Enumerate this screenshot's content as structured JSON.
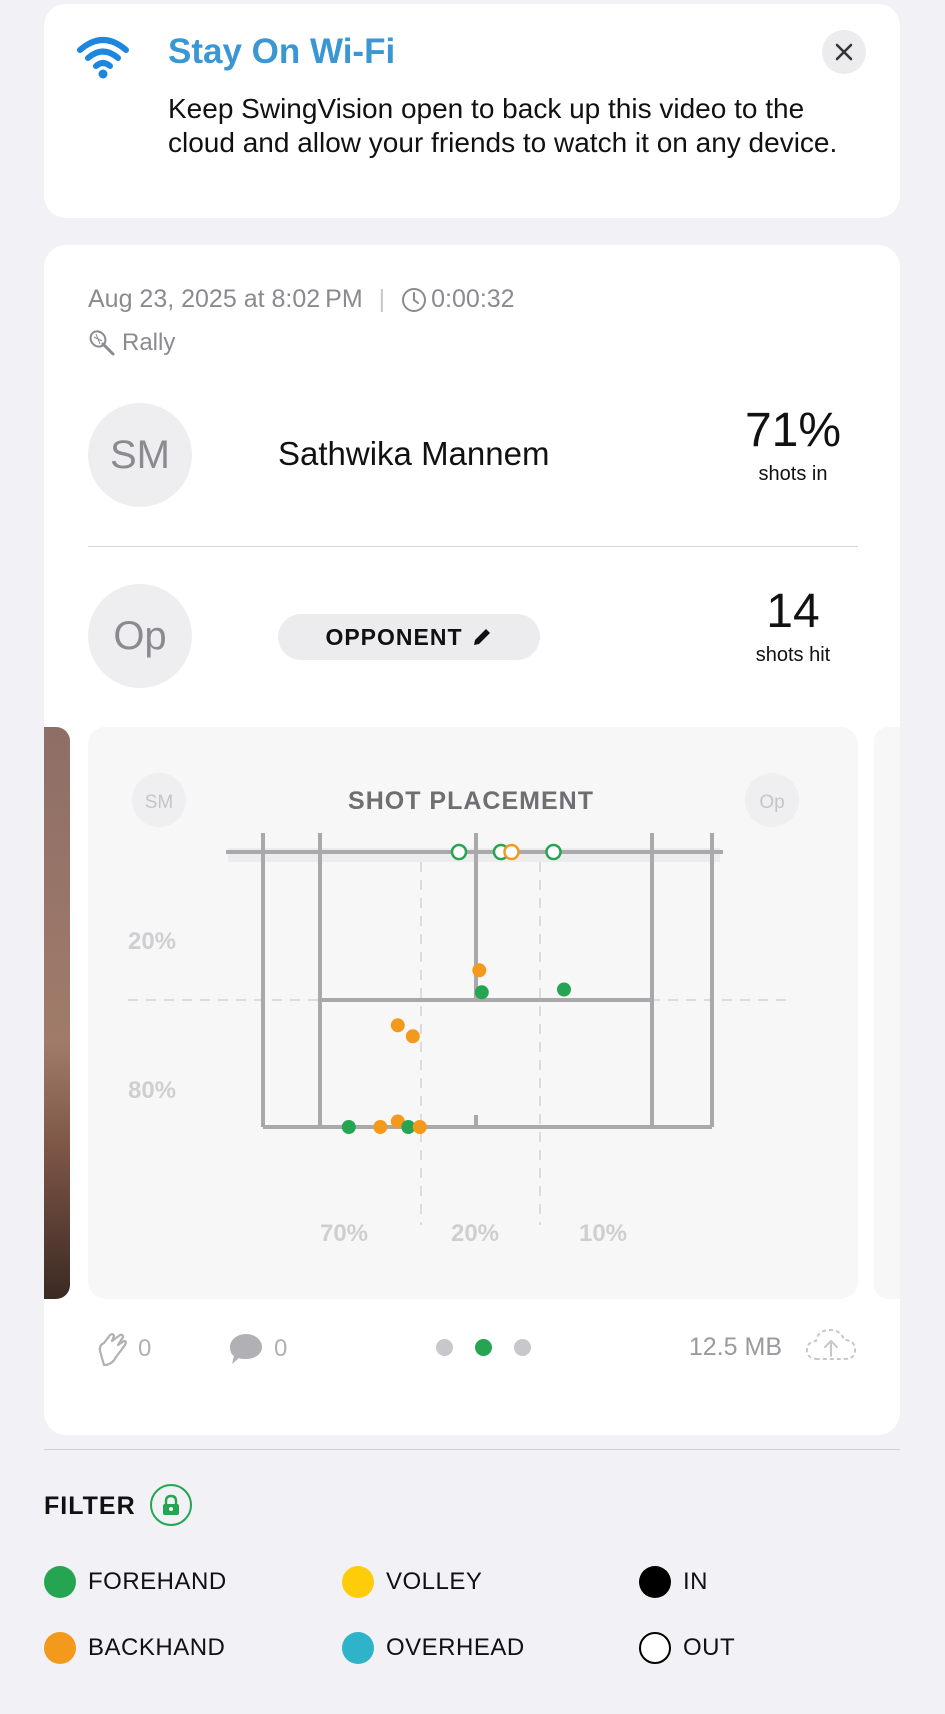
{
  "banner": {
    "title": "Stay On Wi-Fi",
    "body": "Keep SwingVision open to back up this video to the cloud and allow your friends to watch it on any device."
  },
  "session": {
    "date": "Aug 23, 2025 at 8:02 PM",
    "duration": "0:00:32",
    "mode": "Rally"
  },
  "player": {
    "initials": "SM",
    "name": "Sathwika Mannem",
    "stat_value": "71%",
    "stat_label": "shots in"
  },
  "opponent": {
    "initials": "Op",
    "label": "OPPONENT",
    "stat_value": "14",
    "stat_label": "shots hit"
  },
  "placement": {
    "title": "SHOT PLACEMENT",
    "left_badge": "SM",
    "right_badge": "Op",
    "depth_labels": [
      "20%",
      "80%"
    ],
    "width_labels": [
      "70%",
      "20%",
      "10%"
    ],
    "colors": {
      "forehand": "#25a551",
      "backhand": "#f39a1d",
      "line": "#a9a9ab"
    },
    "shots": [
      {
        "type": "forehand",
        "result": "out",
        "lateral": 0.44,
        "depth": 0.0
      },
      {
        "type": "forehand",
        "result": "out",
        "lateral": 0.56,
        "depth": 0.0
      },
      {
        "type": "backhand",
        "result": "out",
        "lateral": 0.59,
        "depth": 0.0
      },
      {
        "type": "forehand",
        "result": "out",
        "lateral": 0.71,
        "depth": 0.0
      },
      {
        "type": "backhand",
        "result": "in",
        "lateral": 0.498,
        "depth": 0.43
      },
      {
        "type": "forehand",
        "result": "in",
        "lateral": 0.505,
        "depth": 0.51
      },
      {
        "type": "forehand",
        "result": "in",
        "lateral": 0.74,
        "depth": 0.5
      },
      {
        "type": "backhand",
        "result": "in",
        "lateral": 0.265,
        "depth": 0.63
      },
      {
        "type": "backhand",
        "result": "in",
        "lateral": 0.308,
        "depth": 0.67
      },
      {
        "type": "forehand",
        "result": "in",
        "lateral": 0.125,
        "depth": 1.0
      },
      {
        "type": "backhand",
        "result": "in",
        "lateral": 0.215,
        "depth": 1.0
      },
      {
        "type": "backhand",
        "result": "in",
        "lateral": 0.265,
        "depth": 0.98
      },
      {
        "type": "forehand",
        "result": "in",
        "lateral": 0.295,
        "depth": 1.0
      },
      {
        "type": "backhand",
        "result": "in",
        "lateral": 0.328,
        "depth": 1.0
      }
    ]
  },
  "footer": {
    "claps": "0",
    "comments": "0",
    "page_count": 3,
    "active_page": 2,
    "size": "12.5 MB"
  },
  "filter": {
    "title": "FILTER",
    "legend": [
      {
        "label": "FOREHAND",
        "color": "#25a551",
        "style": "filled"
      },
      {
        "label": "VOLLEY",
        "color": "#ffcc0a",
        "style": "filled"
      },
      {
        "label": "IN",
        "color": "#000000",
        "style": "filled"
      },
      {
        "label": "BACKHAND",
        "color": "#f39a1d",
        "style": "filled"
      },
      {
        "label": "OVERHEAD",
        "color": "#2fb3c9",
        "style": "filled"
      },
      {
        "label": "OUT",
        "color": "#000000",
        "style": "outline"
      }
    ]
  }
}
